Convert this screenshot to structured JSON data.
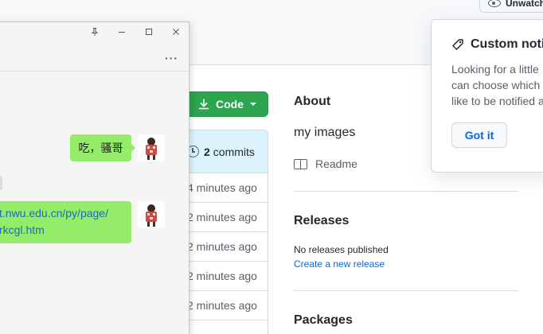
{
  "github": {
    "watch_label": "Unwatch",
    "code_button": "Code",
    "commits": {
      "count": "2",
      "label": "commits"
    },
    "file_times": [
      "4 minutes ago",
      "2 minutes ago",
      "2 minutes ago",
      "2 minutes ago",
      "2 minutes ago"
    ],
    "about": {
      "title": "About",
      "description": "my images",
      "readme": "Readme"
    },
    "releases": {
      "title": "Releases",
      "none": "No releases published",
      "create_link": "Create a new release"
    },
    "packages_title": "Packages"
  },
  "notification_popup": {
    "title": "Custom noti",
    "lines": [
      "Looking for a little",
      "can choose which t",
      "like to be notified a"
    ],
    "got_it": "Got it"
  },
  "chat": {
    "messages": [
      {
        "text": "吃，骚哥"
      },
      {
        "lines": [
          "t.nwu.edu.cn/py/page/",
          "rkcgl.htm"
        ]
      }
    ]
  },
  "colors": {
    "github_green": "#2da44e",
    "link_blue": "#0969da",
    "chat_bubble": "#95ec69"
  }
}
